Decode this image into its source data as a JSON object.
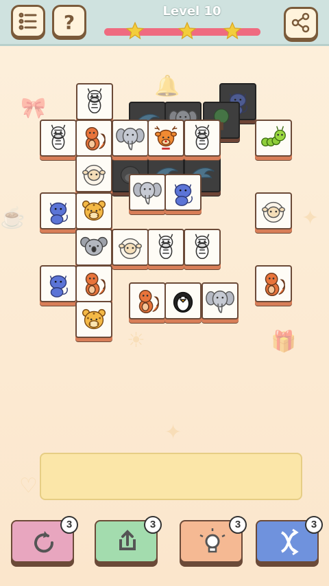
{
  "header": {
    "level_label": "Level 10",
    "progress_fraction": 1.0,
    "stars_earned": 3,
    "menu_icon": "menu-list-icon",
    "help_icon": "question-icon",
    "share_icon": "share-icon"
  },
  "colors": {
    "header_bg": "#cfe2df",
    "progress": "#ef6b80",
    "star": "#f3cd3c",
    "tile_face": "#fefcf6",
    "tile_edge": "#d87e58",
    "tray": "#fbe6a8"
  },
  "board": {
    "tiles": [
      {
        "animal": "zebra",
        "state": "open"
      },
      {
        "animal": "cat",
        "state": "blocked"
      },
      {
        "animal": "dolphin",
        "state": "blocked"
      },
      {
        "animal": "elephant",
        "state": "blocked"
      },
      {
        "animal": "tree",
        "state": "blocked"
      },
      {
        "animal": "zebra",
        "state": "open"
      },
      {
        "animal": "squirrel",
        "state": "open"
      },
      {
        "animal": "elephant",
        "state": "open"
      },
      {
        "animal": "deer",
        "state": "open"
      },
      {
        "animal": "zebra",
        "state": "open"
      },
      {
        "animal": "caterpillar",
        "state": "open"
      },
      {
        "animal": "sheep",
        "state": "open"
      },
      {
        "animal": "gorilla",
        "state": "blocked"
      },
      {
        "animal": "dolphin",
        "state": "blocked"
      },
      {
        "animal": "dolphin",
        "state": "blocked"
      },
      {
        "animal": "elephant",
        "state": "open"
      },
      {
        "animal": "cat",
        "state": "open"
      },
      {
        "animal": "cat",
        "state": "open"
      },
      {
        "animal": "leopard",
        "state": "open"
      },
      {
        "animal": "sheep",
        "state": "open"
      },
      {
        "animal": "koala",
        "state": "open"
      },
      {
        "animal": "sheep",
        "state": "open"
      },
      {
        "animal": "zebra",
        "state": "open"
      },
      {
        "animal": "zebra",
        "state": "open"
      },
      {
        "animal": "cat",
        "state": "open"
      },
      {
        "animal": "squirrel",
        "state": "open"
      },
      {
        "animal": "squirrel",
        "state": "open"
      },
      {
        "animal": "squirrel",
        "state": "open"
      },
      {
        "animal": "penguin",
        "state": "open"
      },
      {
        "animal": "elephant",
        "state": "open"
      },
      {
        "animal": "leopard",
        "state": "open"
      }
    ]
  },
  "tray": {
    "slots_filled": 0
  },
  "powerups": [
    {
      "name": "undo",
      "icon": "undo-icon",
      "count": "3",
      "color": "#e8a6bf"
    },
    {
      "name": "shuffle-out",
      "icon": "upload-icon",
      "count": "3",
      "color": "#a3dcae"
    },
    {
      "name": "hint",
      "icon": "lightbulb-icon",
      "count": "3",
      "color": "#f5b993"
    },
    {
      "name": "shuffle",
      "icon": "shuffle-icon",
      "count": "3",
      "color": "#6f92dd"
    }
  ]
}
